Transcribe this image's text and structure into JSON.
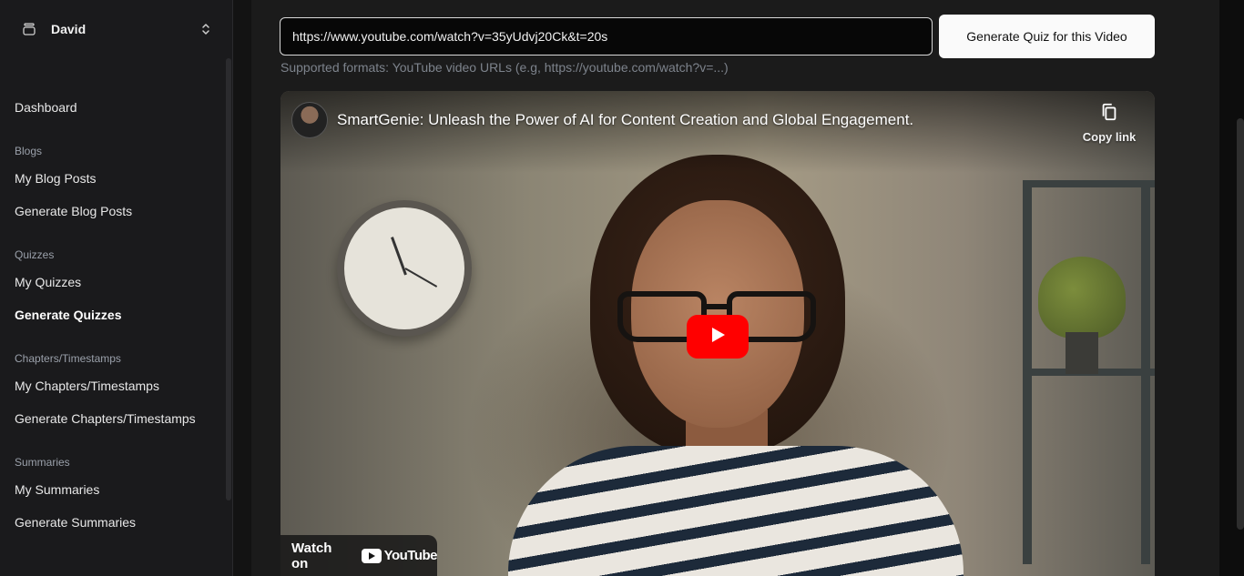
{
  "user": {
    "name": "David"
  },
  "sidebar": {
    "dashboard": "Dashboard",
    "sections": [
      {
        "title": "Blogs",
        "items": [
          "My Blog Posts",
          "Generate Blog Posts"
        ]
      },
      {
        "title": "Quizzes",
        "items": [
          "My Quizzes",
          "Generate Quizzes"
        ]
      },
      {
        "title": "Chapters/Timestamps",
        "items": [
          "My Chapters/Timestamps",
          "Generate Chapters/Timestamps"
        ]
      },
      {
        "title": "Summaries",
        "items": [
          "My Summaries",
          "Generate Summaries"
        ]
      }
    ],
    "active_item": "Generate Quizzes"
  },
  "form": {
    "url_value": "https://www.youtube.com/watch?v=35yUdvj20Ck&t=20s",
    "generate_button": "Generate Quiz for this Video",
    "hint": "Supported formats: YouTube video URLs (e.g, https://youtube.com/watch?v=...)"
  },
  "video": {
    "title": "SmartGenie: Unleash the Power of AI for Content Creation and Global Engagement.",
    "copy_link": "Copy link",
    "watch_on": "Watch on",
    "youtube_wordmark": "YouTube"
  },
  "colors": {
    "background": "#131313",
    "sidebar": "#1a1a1c",
    "button_bg": "#fafafa",
    "youtube_red": "#ff0000"
  },
  "icons": [
    "chevron-updown-icon",
    "user-stack-icon",
    "copy-icon",
    "play-icon",
    "youtube-logo-icon"
  ]
}
